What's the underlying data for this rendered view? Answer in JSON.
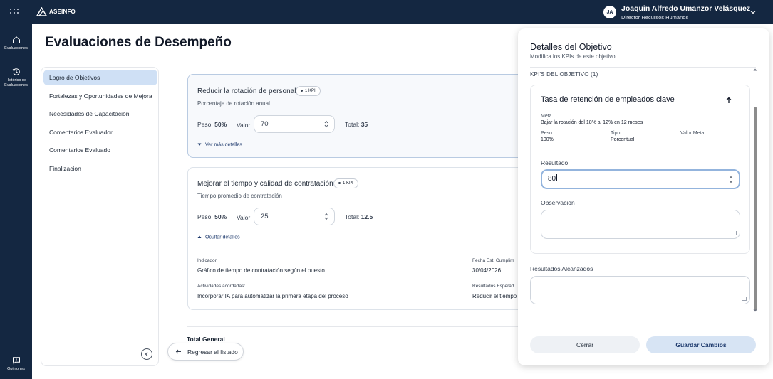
{
  "topbar": {
    "brand": "ASEINFO",
    "user_initials": "JA",
    "user_name": "Joaquin Alfredo Umanzor Velásquez",
    "user_role": "Director Recursos Humanos"
  },
  "rail": {
    "items": [
      {
        "label": "Evaluaciones"
      },
      {
        "label_line1": "Histórico de",
        "label_line2": "Evaluaciones"
      },
      {
        "label": "Opiniones"
      }
    ]
  },
  "page": {
    "title": "Evaluaciones de Desempeño",
    "nav": [
      "Logro de Objetivos",
      "Fortalezas y Oportunidades de Mejora",
      "Necesidades de Capacitación",
      "Comentarios Evaluador",
      "Comentarios Evaluado",
      "Finalizacion"
    ],
    "total_general": "Total General",
    "back_label": "Regresar al listado"
  },
  "objectives": [
    {
      "title": "Reducir la rotación de personal",
      "kpi_badge": "1 KPI",
      "subtitle": "Porcentaje de rotación anual",
      "peso_label": "Peso:",
      "peso_value": "50%",
      "valor_label": "Valor:",
      "valor_value": "70",
      "total_label": "Total:",
      "total_value": "35",
      "toggle_label": "Ver más detalles"
    },
    {
      "title": "Mejorar el tiempo y calidad de contratación",
      "kpi_badge": "1 KPI",
      "subtitle": "Tiempo promedio de contratación",
      "peso_label": "Peso:",
      "peso_value": "50%",
      "valor_label": "Valor:",
      "valor_value": "25",
      "total_label": "Total:",
      "total_value": "12.5",
      "toggle_label": "Ocultar detalles",
      "details": {
        "indicador_label": "Indicador:",
        "indicador_value": "Gráfico de tiempo de contratación según el puesto",
        "fecha_label": "Fecha Est. Cumplim",
        "fecha_value": "30/04/2026",
        "actividades_label": "Actividades acordadas:",
        "actividades_value": "Incorporar IA para automatizar la primera etapa del proceso",
        "resultados_label": "Resultados Esperad",
        "resultados_value": "Reducir el tiempo"
      }
    }
  ],
  "panel": {
    "title": "Detalles del Objetivo",
    "subtitle": "Modifica los KPIs de este objetivo",
    "section_label": "KPI'S DEL OBJETIVO (1)",
    "kpi": {
      "title": "Tasa de retención de empleados clave",
      "meta_label": "Meta",
      "meta_value": "Bajar la rotación del 18% al 12% en 12 meses",
      "peso_label": "Peso",
      "peso_value": "100%",
      "tipo_label": "Tipo",
      "tipo_value": "Porcentual",
      "valor_meta_label": "Valor Meta",
      "resultado_label": "Resultado",
      "resultado_value": "80",
      "observacion_label": "Observación"
    },
    "resultados_alcanzados_label": "Resultados Alcanzados",
    "btn_cerrar": "Cerrar",
    "btn_guardar": "Guardar Cambios"
  }
}
